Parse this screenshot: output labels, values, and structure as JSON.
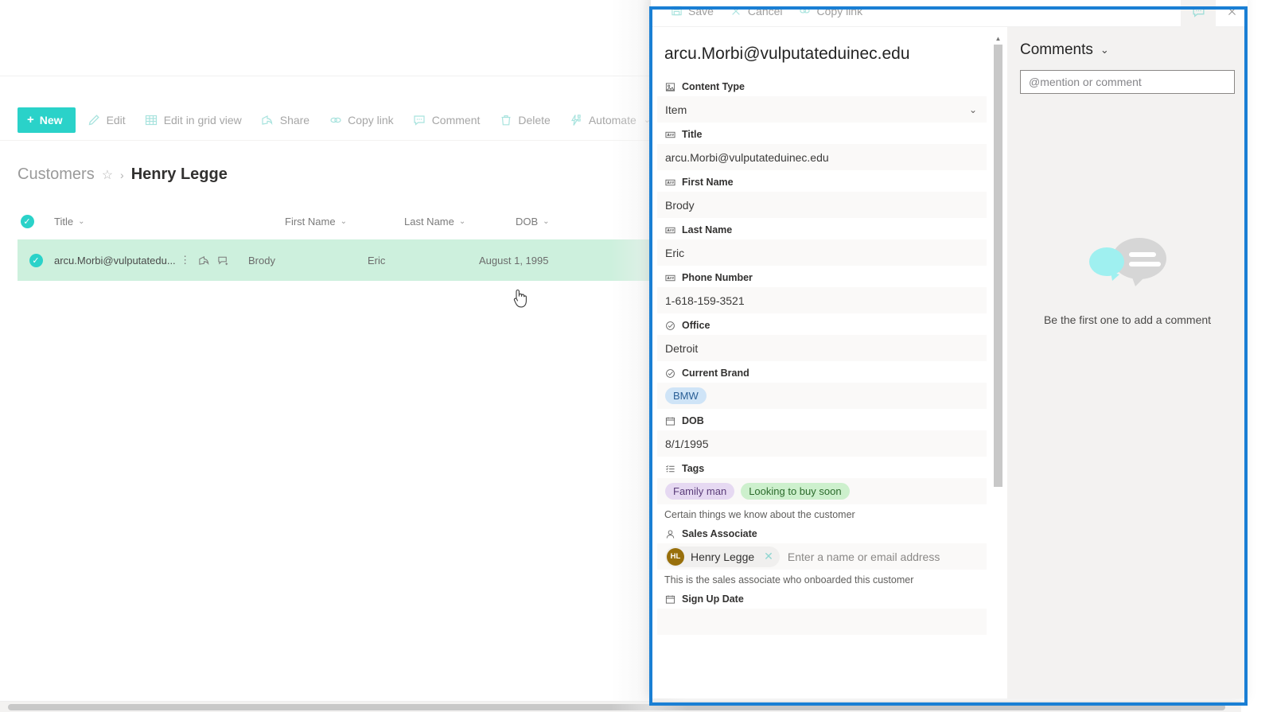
{
  "list_page": {
    "command_bar": {
      "new_label": "New",
      "commands": [
        {
          "label": "Edit",
          "icon": "pencil-icon"
        },
        {
          "label": "Edit in grid view",
          "icon": "grid-icon"
        },
        {
          "label": "Share",
          "icon": "share-icon"
        },
        {
          "label": "Copy link",
          "icon": "link-icon"
        },
        {
          "label": "Comment",
          "icon": "comment-icon"
        },
        {
          "label": "Delete",
          "icon": "trash-icon"
        },
        {
          "label": "Automate",
          "icon": "automate-icon",
          "has_chevron": true
        }
      ],
      "overflow_label": "···"
    },
    "breadcrumb": {
      "root": "Customers",
      "separator": "›",
      "current": "Henry Legge",
      "favorite_icon": "star-icon"
    },
    "table": {
      "columns": [
        "Title",
        "First Name",
        "Last Name",
        "DOB"
      ],
      "rows": [
        {
          "title": "arcu.Morbi@vulputatedu...",
          "first_name": "Brody",
          "last_name": "Eric",
          "dob": "August 1, 1995",
          "selected": true
        }
      ]
    }
  },
  "panel": {
    "commands": {
      "save": "Save",
      "cancel": "Cancel",
      "copy_link": "Copy link",
      "comments_toggle_icon": "comment-icon",
      "close_icon": "close-icon"
    },
    "item_title": "arcu.Morbi@vulputateduinec.edu",
    "fields": [
      {
        "label": "Content Type",
        "icon": "content-type-icon",
        "type": "dropdown",
        "value": "Item",
        "chevron": "⌄"
      },
      {
        "label": "Title",
        "icon": "text-icon",
        "type": "text",
        "value": "arcu.Morbi@vulputateduinec.edu"
      },
      {
        "label": "First Name",
        "icon": "text-icon",
        "type": "text",
        "value": "Brody"
      },
      {
        "label": "Last Name",
        "icon": "text-icon",
        "type": "text",
        "value": "Eric"
      },
      {
        "label": "Phone Number",
        "icon": "text-icon",
        "type": "text",
        "value": "1-618-159-3521"
      },
      {
        "label": "Office",
        "icon": "choice-icon",
        "type": "text",
        "value": "Detroit"
      },
      {
        "label": "Current Brand",
        "icon": "choice-icon",
        "type": "pill",
        "value": "BMW"
      },
      {
        "label": "DOB",
        "icon": "calendar-icon",
        "type": "text",
        "value": "8/1/1995"
      },
      {
        "label": "Tags",
        "icon": "tags-icon",
        "type": "pills",
        "values": [
          "Family man",
          "Looking to buy soon"
        ],
        "description": "Certain things we know about the customer"
      },
      {
        "label": "Sales Associate",
        "icon": "person-icon",
        "type": "person",
        "person_name": "Henry Legge",
        "person_initials": "HL",
        "remove_icon": "close-icon",
        "placeholder": "Enter a name or email address",
        "description": "This is the sales associate who onboarded this customer"
      },
      {
        "label": "Sign Up Date",
        "icon": "calendar-icon",
        "type": "text",
        "value": ""
      }
    ]
  },
  "comments": {
    "header": "Comments",
    "collapse_icon": "chevron-down-icon",
    "input_placeholder": "@mention or comment",
    "empty_text": "Be the first one to add a comment",
    "empty_illustration": "speech-bubbles-icon"
  },
  "colors": {
    "accent": "#2ad2c9",
    "selected_row": "#cdf0dd",
    "highlight_border": "#1a7fd4",
    "brand_pill": "#cfe4f7",
    "tag_purple": "#e6d9f2",
    "tag_green": "#cdf0cd",
    "avatar": "#986f0b"
  }
}
